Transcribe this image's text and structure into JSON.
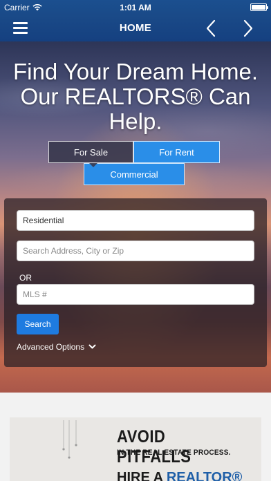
{
  "status_bar": {
    "carrier": "Carrier",
    "time": "1:01 AM"
  },
  "nav": {
    "title": "HOME",
    "menu_icon": "hamburger-menu-icon",
    "prev_icon": "chevron-left-icon",
    "next_icon": "chevron-right-icon"
  },
  "hero": {
    "title_line1": "Find Your Dream Home.",
    "title_line2": "Our REALTORS® Can",
    "title_line3": "Help."
  },
  "tabs": {
    "for_sale": "For Sale",
    "for_rent": "For Rent",
    "commercial": "Commercial",
    "selected": "For Sale"
  },
  "search": {
    "property_type_value": "Residential",
    "address_placeholder": "Search Address, City or Zip",
    "or_label": "OR",
    "mls_placeholder": "MLS #",
    "search_button": "Search",
    "advanced_options": "Advanced Options"
  },
  "ad": {
    "line1": "AVOID PITFALLS",
    "line2": "IN THE REAL ESTATE PROCESS.",
    "line3_prefix": "HIRE A ",
    "line3_brand": "REALTOR®"
  },
  "colors": {
    "nav_blue": "#1a4a88",
    "tab_active_blue": "#2a8ee8",
    "button_blue": "#1e7be0"
  }
}
